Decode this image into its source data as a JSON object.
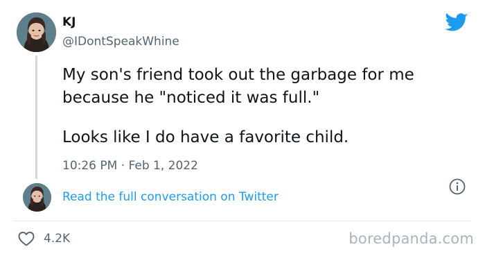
{
  "tweet": {
    "display_name": "KJ",
    "handle": "@IDontSpeakWhine",
    "text_line_1": "My son's friend took out the garbage for me",
    "text_line_2": "because he \"noticed it was full.\"",
    "text_line_3": "Looks like I do have a favorite child.",
    "timestamp": "10:26 PM · Feb 1, 2022",
    "read_more_link": "Read the full conversation on Twitter",
    "like_count": "4.2K"
  },
  "branding": {
    "watermark": "boredpanda.com"
  },
  "icons": {
    "bird": "twitter-bird-icon",
    "info": "info-icon",
    "heart": "heart-icon"
  },
  "colors": {
    "twitter_blue": "#1d9bf0",
    "secondary_text": "#536471",
    "primary_text": "#0f1419"
  }
}
